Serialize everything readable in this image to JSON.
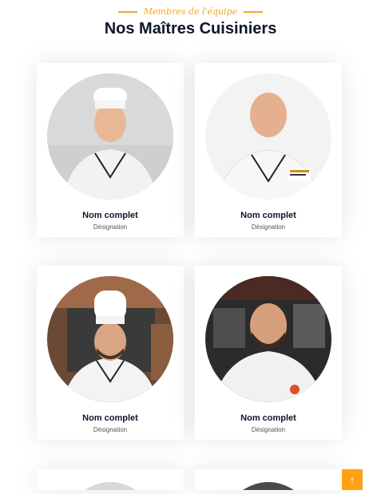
{
  "section": {
    "eyebrow": "Membres de l'équipe",
    "title": "Nos Maîtres Cuisiniers"
  },
  "team": [
    {
      "name": "Nom complet",
      "designation": "Désignation"
    },
    {
      "name": "Nom complet",
      "designation": "Désignation"
    },
    {
      "name": "Nom complet",
      "designation": "Désignation"
    },
    {
      "name": "Nom complet",
      "designation": "Désignation"
    }
  ],
  "scroll_top": {
    "icon": "arrow-up-icon",
    "glyph": "↑"
  },
  "colors": {
    "accent": "#f5a623",
    "scroll_bg": "#fea116",
    "heading": "#0f172b"
  }
}
